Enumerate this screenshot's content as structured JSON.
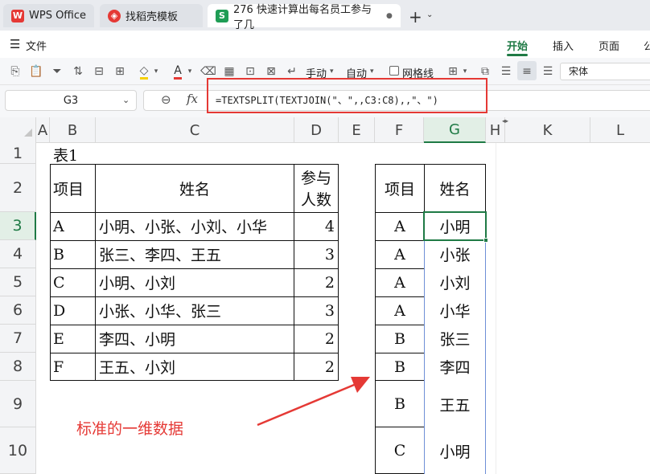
{
  "tabs": [
    {
      "label": "WPS Office",
      "icon": "wps-logo-icon"
    },
    {
      "label": "找稻壳模板",
      "icon": "docer-icon"
    },
    {
      "label": "276 快速计算出每名员工参与了几",
      "icon": "sheet-s-icon",
      "icon_letter": "S"
    }
  ],
  "menu": {
    "file_label": "文件",
    "items": [
      "开始",
      "插入",
      "页面",
      "公"
    ]
  },
  "toolbar": {
    "wrap_manual": "手动",
    "wrap_auto": "自动",
    "gridlines_label": "网格线",
    "font_name": "宋体"
  },
  "namebox": {
    "value": "G3"
  },
  "fx_label": "fx",
  "formula": "=TEXTSPLIT(TEXTJOIN(\"、\",,C3:C8),,\"、\")",
  "columns": [
    "A",
    "B",
    "C",
    "D",
    "E",
    "F",
    "G",
    "H",
    "K",
    "L"
  ],
  "rows": [
    "1",
    "2",
    "3",
    "4",
    "5",
    "6",
    "7",
    "8",
    "9",
    "10"
  ],
  "sheet": {
    "title": "表1",
    "left_headers": {
      "item": "项目",
      "name": "姓名",
      "count_line1": "参与",
      "count_line2": "人数"
    },
    "left_rows": [
      {
        "item": "A",
        "names": "小明、小张、小刘、小华",
        "count": "4"
      },
      {
        "item": "B",
        "names": "张三、李四、王五",
        "count": "3"
      },
      {
        "item": "C",
        "names": "小明、小刘",
        "count": "2"
      },
      {
        "item": "D",
        "names": "小张、小华、张三",
        "count": "3"
      },
      {
        "item": "E",
        "names": "李四、小明",
        "count": "2"
      },
      {
        "item": "F",
        "names": "王五、小刘",
        "count": "2"
      }
    ],
    "right_headers": {
      "item": "项目",
      "name": "姓名"
    },
    "right_rows": [
      {
        "item": "A",
        "name": "小明"
      },
      {
        "item": "A",
        "name": "小张"
      },
      {
        "item": "A",
        "name": "小刘"
      },
      {
        "item": "A",
        "name": "小华"
      },
      {
        "item": "B",
        "name": "张三"
      },
      {
        "item": "B",
        "name": "李四"
      },
      {
        "item": "B",
        "name": "王五"
      },
      {
        "item": "C",
        "name": "小明"
      }
    ],
    "annotation": "标准的一维数据"
  },
  "colors": {
    "accent_green": "#1f7a45",
    "highlight_red": "#e53935",
    "annotation_red": "#e53935"
  }
}
